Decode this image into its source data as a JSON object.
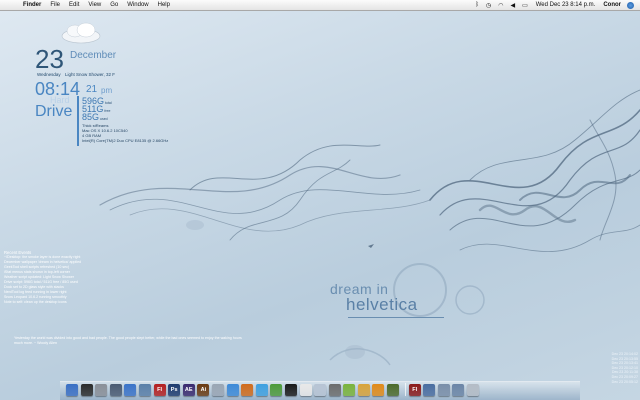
{
  "menubar": {
    "apple_glyph": "",
    "items": [
      "Finder",
      "File",
      "Edit",
      "View",
      "Go",
      "Window",
      "Help"
    ],
    "status_icons": [
      "bluetooth-icon",
      "time-machine-icon",
      "wifi-icon",
      "volume-icon",
      "battery-icon"
    ],
    "clock": "Wed Dec 23  8:14 p.m.",
    "user": "Conor"
  },
  "widgets": {
    "date": {
      "day": "23",
      "month": "December",
      "weekday": "Wednesday"
    },
    "weather": {
      "condition": "Light Snow Shower, 32 F",
      "icon": "cloud-icon"
    },
    "time": {
      "hour_min": "08:14",
      "min_small": "21",
      "ampm": "pm"
    },
    "drive": {
      "hard_label": "Hard",
      "word": "Drive",
      "stats": [
        {
          "value": "596G",
          "unit": "total"
        },
        {
          "value": "511G",
          "unit": "free"
        },
        {
          "value": "85G",
          "unit": "used"
        }
      ]
    },
    "system": [
      "Thick stReams",
      "Mac OS X 10.6.2 10C540",
      "4 GB RAM",
      "Intel(R) Core(TM)2 Duo CPU    E8135 @ 2.66GHz"
    ]
  },
  "notes": {
    "title": "Recent Events",
    "lines": [
      "~/Desktop: the smoke layer is done exactly right",
      "December wallpaper 'dream in helvetica' applied",
      "GeekTool shell scripts refreshed (10 sec)",
      "iStat menus stats shown in top-left corner",
      "Weather script updated: Light Snow Shower",
      "Drive script: 596G total / 511G free / 85G used",
      "Dock set to 2D glass style with stacks",
      "NerdTool log feed running in lower right",
      "Snow Leopard 10.6.2 running smoothly",
      "Note to self: clean up the desktop icons"
    ],
    "bottom": "Yesterday the world was divided into good and bad people. The good people slept better, while the bad ones seemed to enjoy the waking hours much more. ~ Woody Allen"
  },
  "log": {
    "lines": [
      "Dec 23 20:14:02",
      "Dec 23 20:13:55",
      "Dec 23 20:13:41",
      "Dec 23 20:12:10",
      "Dec 23 20:11:38",
      "Dec 23 20:09:27",
      "Dec 23 20:05:12"
    ]
  },
  "wallpaper": {
    "line1": "dream in",
    "line2": "helvetica"
  },
  "dock": {
    "apps": [
      {
        "name": "finder",
        "label": "",
        "color": "#3a6fc4"
      },
      {
        "name": "dashboard",
        "label": "",
        "color": "#2b2b2b"
      },
      {
        "name": "system-preferences",
        "label": "",
        "color": "#8a8f98"
      },
      {
        "name": "time-machine",
        "label": "",
        "color": "#4a5a72"
      },
      {
        "name": "itunes",
        "label": "",
        "color": "#3b73c8"
      },
      {
        "name": "iphoto",
        "label": "",
        "color": "#5a7fa8"
      },
      {
        "name": "flash",
        "label": "Fl",
        "color": "#b42020"
      },
      {
        "name": "photoshop",
        "label": "Ps",
        "color": "#1f3b6e"
      },
      {
        "name": "after-effects",
        "label": "AE",
        "color": "#3a2a6e"
      },
      {
        "name": "illustrator",
        "label": "Ai",
        "color": "#6a3a12"
      },
      {
        "name": "mail",
        "label": "",
        "color": "#9aa6b4"
      },
      {
        "name": "safari",
        "label": "",
        "color": "#3d8ad8"
      },
      {
        "name": "firefox",
        "label": "",
        "color": "#d06b1c"
      },
      {
        "name": "ichat",
        "label": "",
        "color": "#3fa0e0"
      },
      {
        "name": "adium",
        "label": "",
        "color": "#4d9a3a"
      },
      {
        "name": "terminal",
        "label": "",
        "color": "#1a1a1a"
      },
      {
        "name": "textedit",
        "label": "",
        "color": "#e8e8e8"
      },
      {
        "name": "preview",
        "label": "",
        "color": "#b7c4d4"
      },
      {
        "name": "calculator",
        "label": "",
        "color": "#6c6c6c"
      },
      {
        "name": "coda",
        "label": "",
        "color": "#7ab33c"
      },
      {
        "name": "transmit",
        "label": "",
        "color": "#d8a33a"
      },
      {
        "name": "vlc",
        "label": "",
        "color": "#e08a1a"
      },
      {
        "name": "activity-monitor",
        "label": "",
        "color": "#4c6a2a"
      }
    ],
    "stacks": [
      {
        "name": "flash-document",
        "label": "Fl",
        "color": "#8a1a1a"
      },
      {
        "name": "applications-stack",
        "label": "",
        "color": "#4a6da0"
      },
      {
        "name": "documents-stack",
        "label": "",
        "color": "#7a8ea8"
      },
      {
        "name": "downloads-stack",
        "label": "",
        "color": "#6b85a6"
      },
      {
        "name": "trash",
        "label": "",
        "color": "#b4bcc6"
      }
    ]
  }
}
